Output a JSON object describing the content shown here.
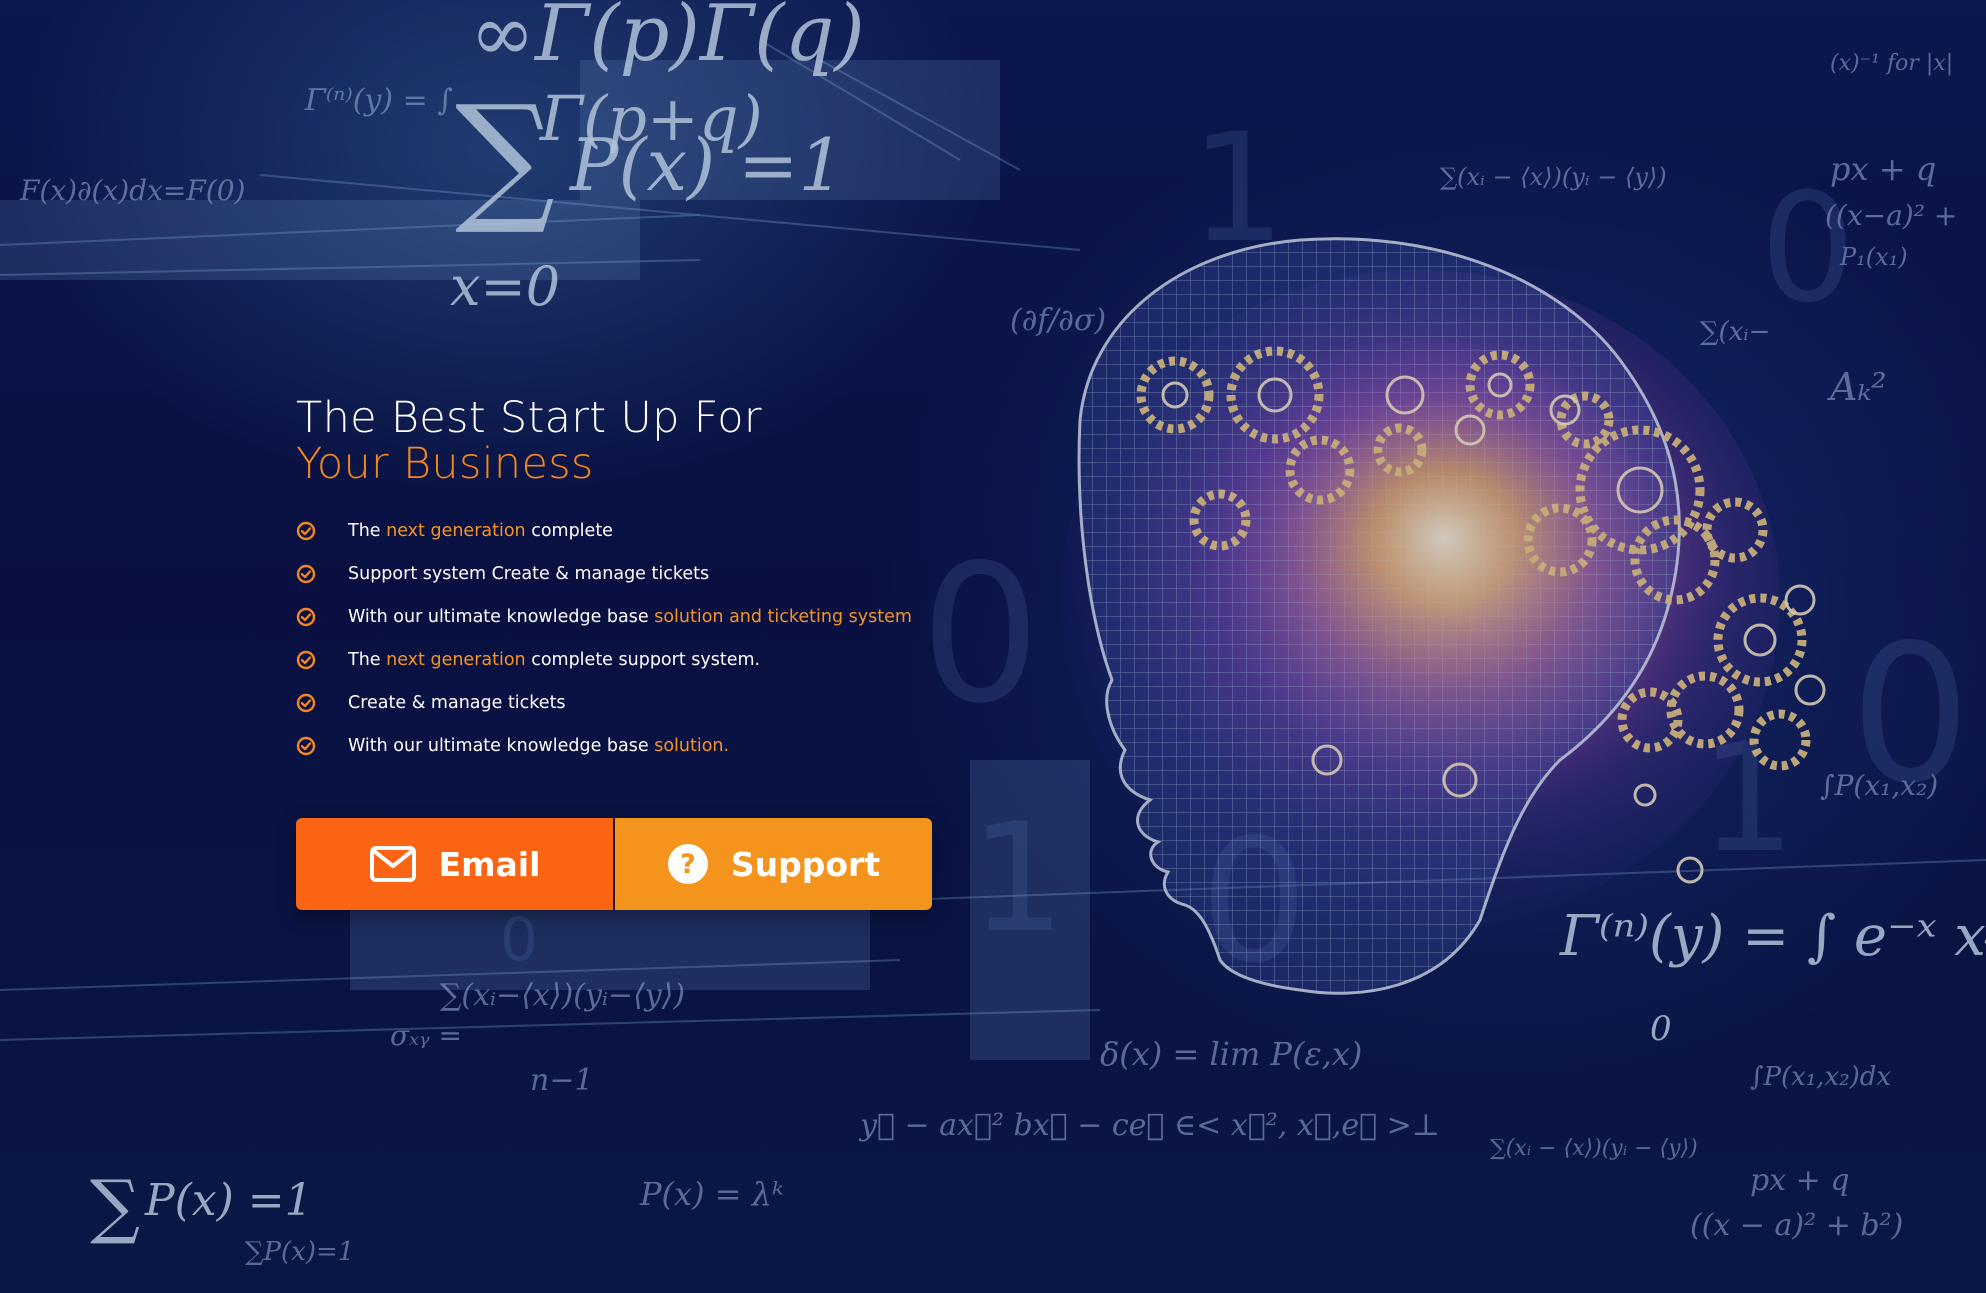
{
  "hero": {
    "title_line1": "The Best Start Up For",
    "title_line2": "Your Business",
    "features": [
      {
        "icon": "check-circle-icon",
        "parts": [
          {
            "text": "The ",
            "highlight": false
          },
          {
            "text": "next generation",
            "highlight": true
          },
          {
            "text": " complete",
            "highlight": false
          }
        ]
      },
      {
        "icon": "check-circle-icon",
        "parts": [
          {
            "text": "Support system Create & manage tickets",
            "highlight": false
          }
        ]
      },
      {
        "icon": "check-circle-icon",
        "parts": [
          {
            "text": "With our ultimate knowledge base ",
            "highlight": false
          },
          {
            "text": "solution and ticketing system",
            "highlight": true
          }
        ]
      },
      {
        "icon": "check-circle-icon",
        "parts": [
          {
            "text": "The ",
            "highlight": false
          },
          {
            "text": "next generation",
            "highlight": true
          },
          {
            "text": " complete support system.",
            "highlight": false
          }
        ]
      },
      {
        "icon": "check-circle-icon",
        "parts": [
          {
            "text": "Create & manage tickets",
            "highlight": false
          }
        ]
      },
      {
        "icon": "check-circle-icon",
        "parts": [
          {
            "text": "With our ultimate knowledge base ",
            "highlight": false
          },
          {
            "text": "solution.",
            "highlight": true
          }
        ]
      }
    ]
  },
  "buttons": {
    "email_label": "Email",
    "email_icon": "envelope-icon",
    "support_label": "Support",
    "support_icon": "question-circle-icon"
  },
  "colors": {
    "accent": "#f2861f",
    "email_button": "#fb6412",
    "support_button": "#f5941d",
    "background": "#0b1240"
  }
}
